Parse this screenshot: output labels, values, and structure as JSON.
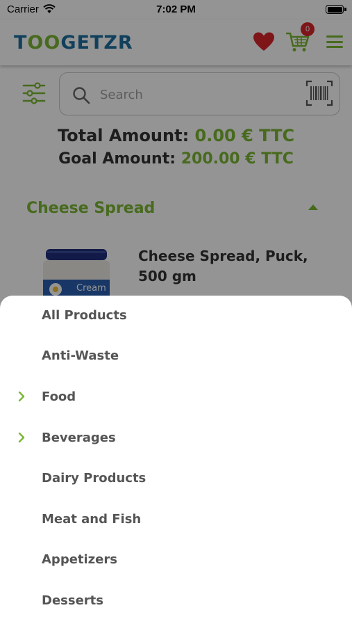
{
  "status_bar": {
    "carrier": "Carrier",
    "time": "7:02 PM"
  },
  "header": {
    "logo_left": "T",
    "logo_oo": "OO",
    "logo_right": "GETZR",
    "cart_count": "0"
  },
  "search": {
    "placeholder": "Search",
    "value": ""
  },
  "summary": {
    "total_label": "Total Amount:",
    "total_value": "0.00 € TTC",
    "goal_label": "Goal Amount:",
    "goal_value": "200.00 € TTC"
  },
  "category": {
    "title": "Cheese Spread"
  },
  "product": {
    "name": "Cheese Spread, Puck, 500 gm",
    "image_text": "Cream"
  },
  "menu": {
    "items": [
      {
        "label": "All Products",
        "has_children": false
      },
      {
        "label": "Anti-Waste",
        "has_children": false
      },
      {
        "label": "Food",
        "has_children": true
      },
      {
        "label": "Beverages",
        "has_children": true
      },
      {
        "label": "Dairy Products",
        "has_children": false
      },
      {
        "label": "Meat and Fish",
        "has_children": false
      },
      {
        "label": "Appetizers",
        "has_children": false
      },
      {
        "label": "Desserts",
        "has_children": false
      }
    ]
  },
  "colors": {
    "brand_green": "#7ab733",
    "brand_blue": "#1e6fa0",
    "heart_red": "#d9252a"
  }
}
